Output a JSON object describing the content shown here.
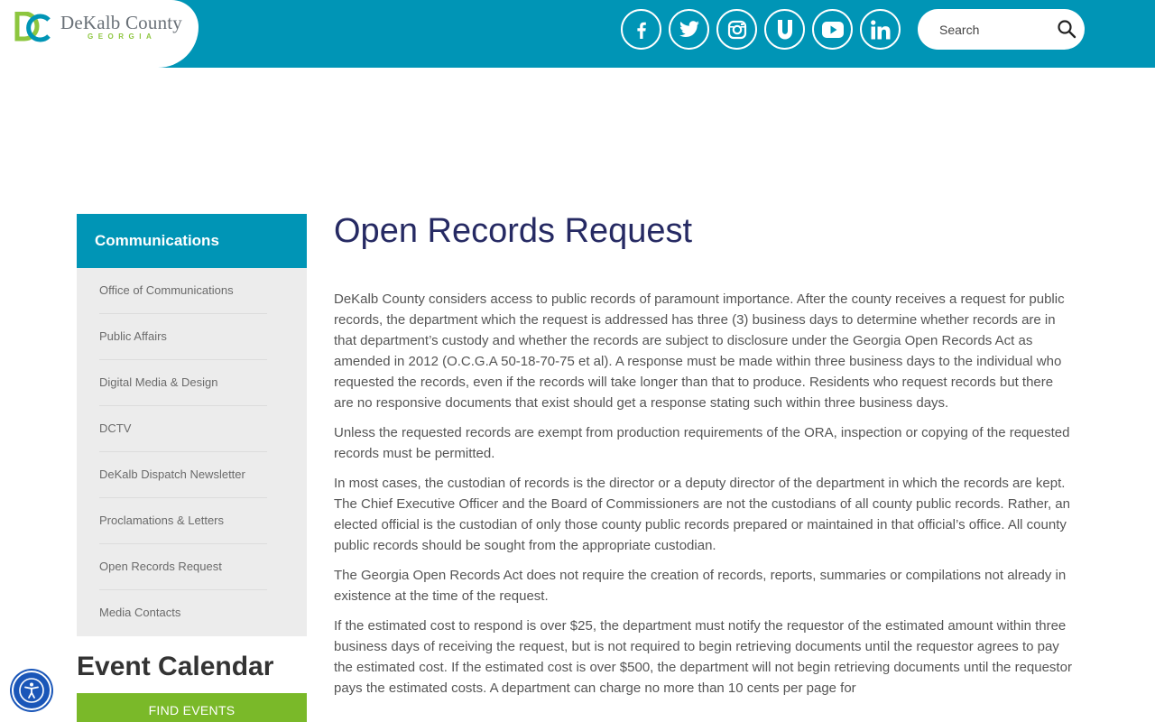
{
  "brand": {
    "name": "DeKalb County",
    "state": "GEORGIA",
    "colors": {
      "teal": "#0095b6",
      "green": "#8dc63f",
      "navy": "#262a63"
    }
  },
  "header": {
    "social": [
      {
        "name": "facebook-icon",
        "glyph": "f"
      },
      {
        "name": "twitter-icon",
        "glyph": "twitter"
      },
      {
        "name": "instagram-icon",
        "glyph": "instagram"
      },
      {
        "name": "ustream-icon",
        "glyph": "U"
      },
      {
        "name": "youtube-icon",
        "glyph": "youtube"
      },
      {
        "name": "linkedin-icon",
        "glyph": "in"
      }
    ],
    "search": {
      "placeholder": "Search"
    }
  },
  "sidebar": {
    "heading": "Communications",
    "items": [
      {
        "label": "Office of Communications"
      },
      {
        "label": "Public Affairs"
      },
      {
        "label": "Digital Media & Design"
      },
      {
        "label": "DCTV"
      },
      {
        "label": "DeKalb Dispatch Newsletter"
      },
      {
        "label": "Proclamations & Letters"
      },
      {
        "label": "Open Records Request"
      },
      {
        "label": "Media Contacts"
      }
    ],
    "event_calendar": {
      "title": "Event Calendar",
      "button": "FIND EVENTS"
    }
  },
  "main": {
    "title": "Open Records Request",
    "paragraphs": [
      "DeKalb County considers access to public records of paramount importance.  After the county receives a request for public records, the department which the request is addressed has three (3) business days to determine whether records are in that department’s custody and whether the records are subject to disclosure under the Georgia Open Records Act as amended in 2012 (O.C.G.A 50-18-70-75 et al).  A response must be made within three business days to the individual who requested the records, even if the records will take longer than that to produce. Residents who request records but there are no responsive documents that exist should get a response stating such within three business days.",
      "Unless the requested records are exempt from production requirements of the ORA, inspection or copying of the requested records must be permitted.",
      "In most cases, the custodian of records is the director or a deputy director of the department in which the records are kept.  The Chief Executive Officer and the Board of Commissioners are not the custodians of all county public records.  Rather, an elected official is the custodian of only those county public records prepared or maintained in that official’s office.  All county public records should be sought from the appropriate custodian.",
      "The Georgia Open Records Act does not require the creation of records, reports, summaries or compilations not already in existence at the time of the request.",
      "If the estimated cost to respond is over $25, the department must notify the requestor of the estimated amount within three business days of receiving the request, but is not required to begin retrieving documents until the requestor agrees to pay the estimated cost.  If the estimated cost is over $500, the department will not begin retrieving documents until the requestor pays the estimated costs.  A department can charge no more than 10 cents per page for"
    ]
  }
}
